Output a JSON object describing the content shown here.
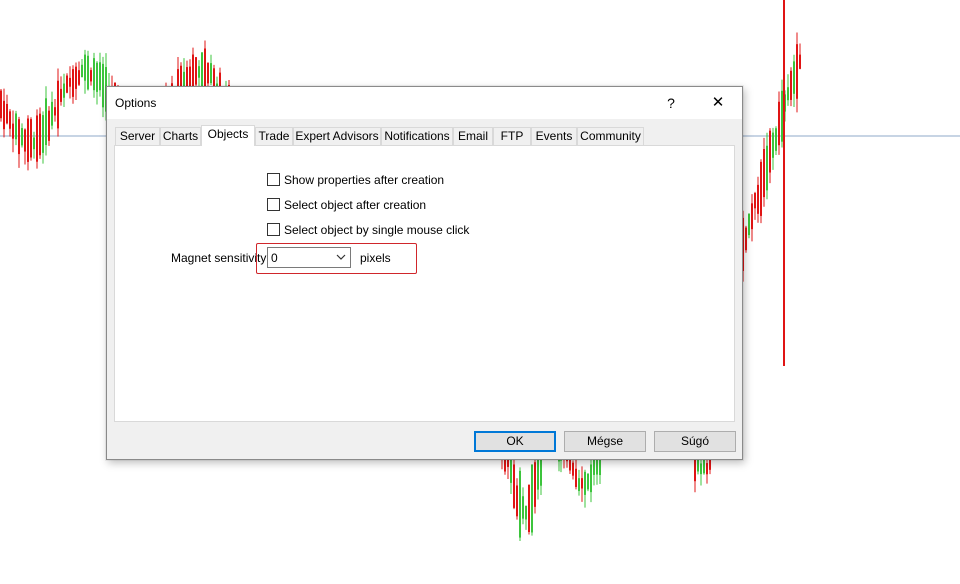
{
  "dialog": {
    "title": "Options",
    "help_glyph": "?",
    "close_glyph": "✕"
  },
  "tabs": [
    {
      "label": "Server"
    },
    {
      "label": "Charts"
    },
    {
      "label": "Objects",
      "active": true
    },
    {
      "label": "Trade"
    },
    {
      "label": "Expert Advisors"
    },
    {
      "label": "Notifications"
    },
    {
      "label": "Email"
    },
    {
      "label": "FTP"
    },
    {
      "label": "Events"
    },
    {
      "label": "Community"
    }
  ],
  "objects": {
    "checkboxes": [
      {
        "label": "Show properties after creation",
        "checked": false
      },
      {
        "label": "Select object after creation",
        "checked": false
      },
      {
        "label": "Select object by single mouse click",
        "checked": false
      }
    ],
    "magnet": {
      "label": "Magnet sensitivity",
      "value": "0",
      "unit": "pixels"
    }
  },
  "buttons": {
    "ok": "OK",
    "cancel": "Mégse",
    "help": "Súgó"
  },
  "colors": {
    "bull_candle": "#3cc43c",
    "bear_candle": "#e01414",
    "highlight": "#d0262b",
    "default_button_border": "#0078d7"
  }
}
